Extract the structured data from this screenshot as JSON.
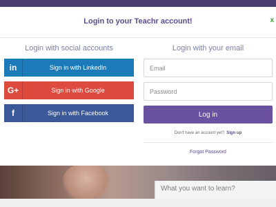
{
  "modal": {
    "title": "Login to your Teachr account!",
    "close_label": "x"
  },
  "social": {
    "heading": "Login with social accounts",
    "linkedin": {
      "icon_text": "in",
      "label": "Sign in with LinkedIn",
      "color": "#1b7ab8"
    },
    "google": {
      "icon_text": "G+",
      "label": "Sign in with Google",
      "color": "#dc4b3e"
    },
    "facebook": {
      "icon_text": "f",
      "label": "Sign in with Facebook",
      "color": "#3b5998"
    }
  },
  "email_login": {
    "heading": "Login with your email",
    "email_placeholder": "Email",
    "password_placeholder": "Password",
    "login_label": "Log in",
    "signup_prompt": "Don't have an account yet?",
    "signup_link": "Sign up",
    "forgot_label": "Forgot Password"
  },
  "background": {
    "search_placeholder": "What you want to learn?"
  },
  "colors": {
    "brand": "#6a52a0",
    "title": "#5d4a8f",
    "close": "#2faa2f"
  }
}
